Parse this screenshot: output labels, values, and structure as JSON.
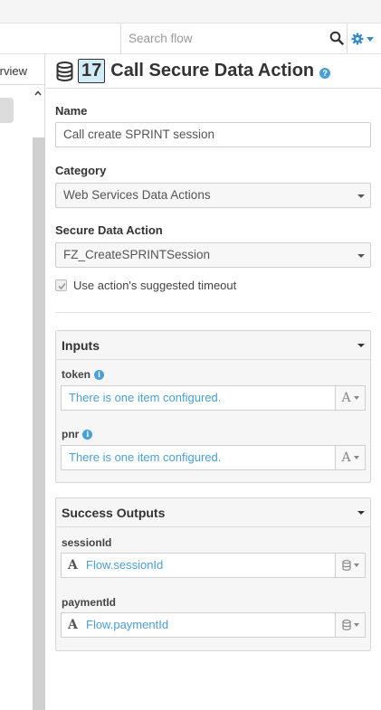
{
  "search": {
    "placeholder": "Search flow"
  },
  "left_panel": {
    "overview_label": "Overview"
  },
  "node": {
    "number": "17",
    "title": "Call Secure Data Action"
  },
  "form": {
    "name_label": "Name",
    "name_value": "Call create SPRINT session",
    "category_label": "Category",
    "category_value": "Web Services Data Actions",
    "action_label": "Secure Data Action",
    "action_value": "FZ_CreateSPRINTSession",
    "timeout_label": "Use action's suggested timeout",
    "timeout_checked": true
  },
  "inputs": {
    "title": "Inputs",
    "items": [
      {
        "label": "token",
        "value": "There is one item configured."
      },
      {
        "label": "pnr",
        "value": "There is one item configured."
      }
    ]
  },
  "outputs": {
    "title": "Success Outputs",
    "items": [
      {
        "label": "sessionId",
        "value": "Flow.sessionId"
      },
      {
        "label": "paymentId",
        "value": "Flow.paymentId"
      }
    ]
  },
  "colors": {
    "accent": "#4a9fd4",
    "badge_bg": "#d2ecf7",
    "section_bg": "#f6f6f6"
  },
  "icons": {
    "search": "search-icon",
    "settings": "gear-icon",
    "node": "database-icon",
    "help": "help-icon",
    "info": "info-icon",
    "string_type": "string-type-icon",
    "variable": "database-icon"
  }
}
